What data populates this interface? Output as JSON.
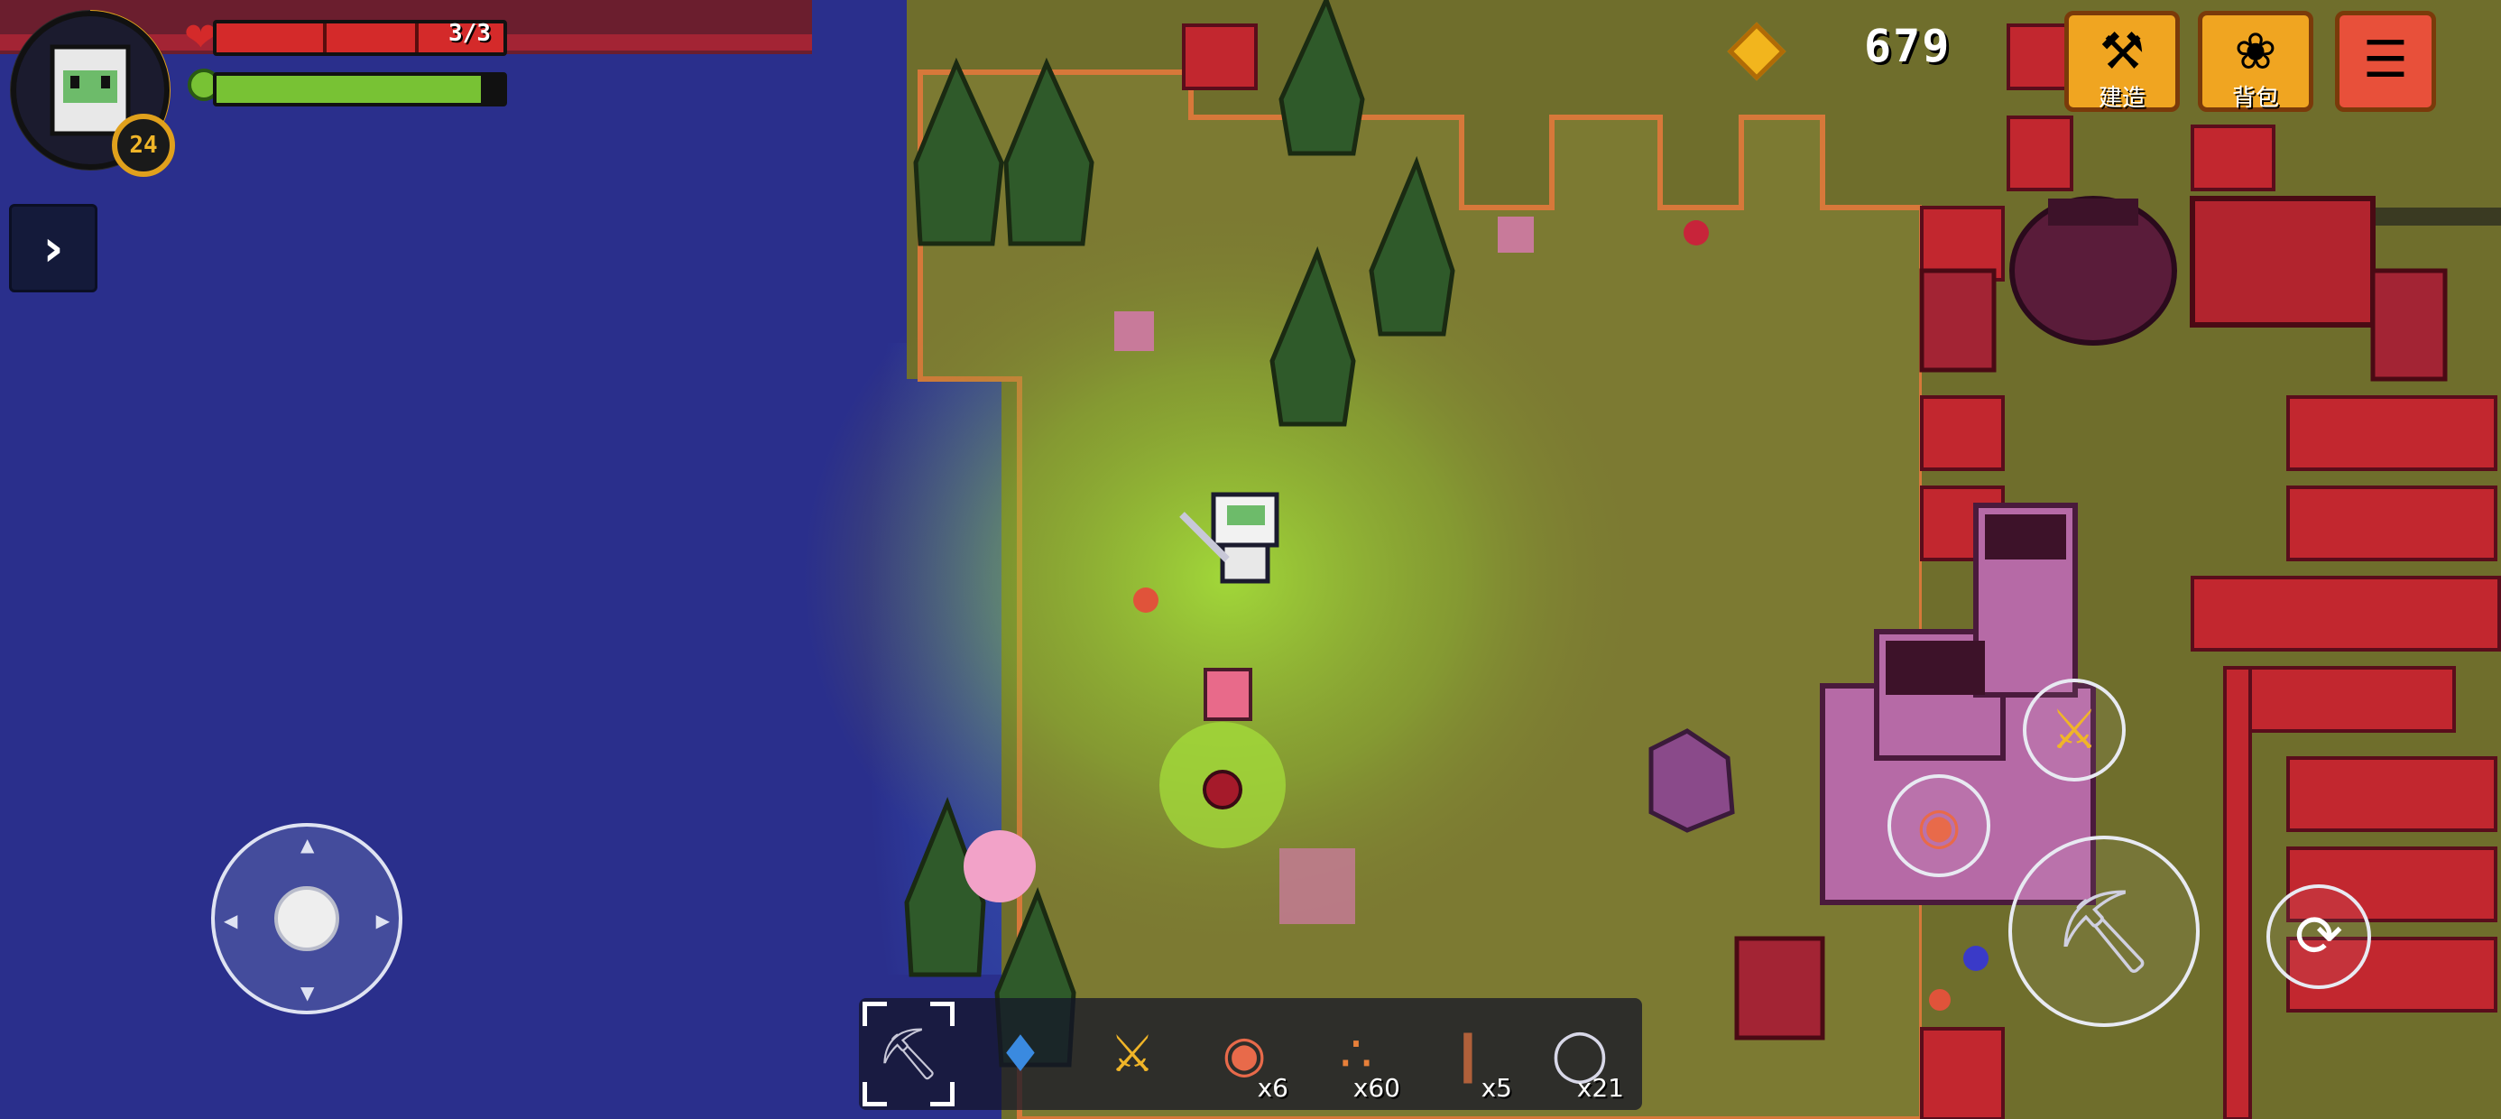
{
  "player": {
    "level": "24",
    "health_text": "3/3",
    "health_fraction": 1.0,
    "energy_fraction": 0.92
  },
  "currency": {
    "coins": "679",
    "icon": "gem-icon"
  },
  "top_buttons": [
    {
      "label": "建造",
      "icon": "anvil-icon"
    },
    {
      "label": "背包",
      "icon": "bag-icon"
    },
    {
      "label": "",
      "icon": "scroll-icon"
    }
  ],
  "hotbar": {
    "selected_index": 0,
    "slots": [
      {
        "icon": "pickaxe-icon",
        "count": ""
      },
      {
        "icon": "shovel-icon",
        "count": ""
      },
      {
        "icon": "sword-icon",
        "count": ""
      },
      {
        "icon": "food-bowl-icon",
        "count": "x6"
      },
      {
        "icon": "seeds-icon",
        "count": "x60"
      },
      {
        "icon": "wood-stick-icon",
        "count": "x5"
      },
      {
        "icon": "glass-bottle-icon",
        "count": "x21"
      }
    ]
  },
  "actions": [
    {
      "name": "attack-button",
      "icon": "pickaxe-icon"
    },
    {
      "name": "quick-weapon-button",
      "icon": "sword-icon"
    },
    {
      "name": "quick-food-button",
      "icon": "food-bowl-icon"
    },
    {
      "name": "roll-button",
      "icon": "roll-icon"
    }
  ],
  "colors": {
    "water": "#2a2f8c",
    "grass": "#7c7a32",
    "cliff": "#c2272f",
    "health": "#d42a2a",
    "energy": "#78c234",
    "accent": "#f0a521"
  }
}
